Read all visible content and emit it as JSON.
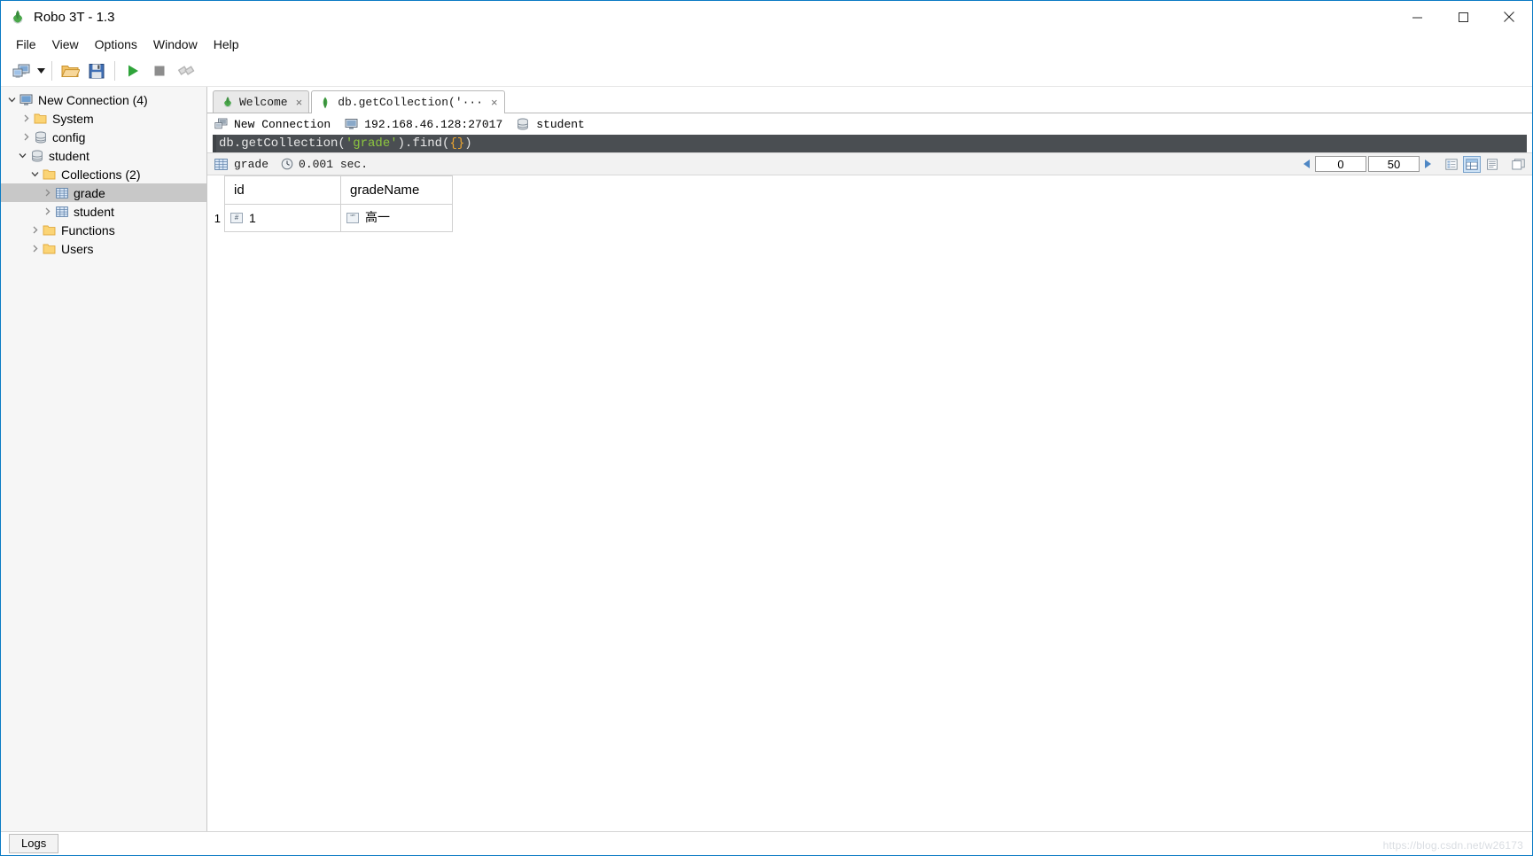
{
  "window": {
    "title": "Robo 3T - 1.3",
    "logo_icon": "robo3t-leaf-logo",
    "minimize_icon": "minimize-icon",
    "maximize_icon": "maximize-icon",
    "close_icon": "close-icon"
  },
  "menubar": {
    "items": [
      {
        "label": "File"
      },
      {
        "label": "View"
      },
      {
        "label": "Options"
      },
      {
        "label": "Window"
      },
      {
        "label": "Help"
      }
    ]
  },
  "toolbar": {
    "buttons": [
      {
        "name": "connect-button",
        "icon": "computer-connect-icon"
      },
      {
        "name": "connect-dropdown",
        "icon": "chevron-down-icon"
      },
      {
        "name": "open-script-button",
        "icon": "open-folder-icon"
      },
      {
        "name": "save-script-button",
        "icon": "floppy-disk-icon"
      },
      {
        "name": "execute-button",
        "icon": "play-triangle-icon"
      },
      {
        "name": "stop-button",
        "icon": "stop-square-icon"
      },
      {
        "name": "orientation-button",
        "icon": "wrench-icon"
      }
    ]
  },
  "sidebar": {
    "tree": [
      {
        "label": "New Connection (4)",
        "icon": "computer-icon",
        "indent": 0,
        "twisty": "expanded",
        "selected": false
      },
      {
        "label": "System",
        "icon": "folder-icon",
        "indent": 1,
        "twisty": "collapsed",
        "selected": false
      },
      {
        "label": "config",
        "icon": "database-icon",
        "indent": 1,
        "twisty": "collapsed",
        "selected": false
      },
      {
        "label": "student",
        "icon": "database-icon",
        "indent": 1,
        "twisty": "expanded",
        "selected": false
      },
      {
        "label": "Collections (2)",
        "icon": "folder-icon",
        "indent": 2,
        "twisty": "expanded",
        "selected": false
      },
      {
        "label": "grade",
        "icon": "collection-grid-icon",
        "indent": 3,
        "twisty": "collapsed",
        "selected": true
      },
      {
        "label": "student",
        "icon": "collection-grid-icon",
        "indent": 3,
        "twisty": "collapsed",
        "selected": false
      },
      {
        "label": "Functions",
        "icon": "folder-icon",
        "indent": 2,
        "twisty": "collapsed",
        "selected": false
      },
      {
        "label": "Users",
        "icon": "folder-icon",
        "indent": 2,
        "twisty": "collapsed",
        "selected": false
      }
    ]
  },
  "tabs": [
    {
      "label": "Welcome",
      "icon": "robo3t-leaf-logo",
      "active": false,
      "close_icon": "close-icon",
      "close_label": "×"
    },
    {
      "label": "db.getCollection('···",
      "icon": "mongo-leaf-icon",
      "active": true,
      "close_icon": "close-icon",
      "close_label": "×"
    }
  ],
  "info_bar": {
    "connection": "New Connection",
    "connection_icon": "server-icon",
    "host": "192.168.46.128:27017",
    "host_icon": "computer-icon",
    "database": "student",
    "database_icon": "database-icon"
  },
  "editor": {
    "prefix": "db.getCollection(",
    "string": "'grade'",
    "middle": ").find(",
    "braces": "{}",
    "suffix": ")"
  },
  "result_toolbar": {
    "grid_icon": "grid-icon",
    "collection_name": "grade",
    "clock_icon": "clock-icon",
    "elapsed": "0.001 sec.",
    "prev_icon": "left-arrow-icon",
    "next_icon": "right-arrow-icon",
    "skip_value": "0",
    "limit_value": "50",
    "view_modes": [
      {
        "name": "tree-view-button",
        "icon": "tree-view-icon",
        "active": false
      },
      {
        "name": "table-view-button",
        "icon": "table-view-icon",
        "active": true
      },
      {
        "name": "text-view-button",
        "icon": "text-view-icon",
        "active": false
      },
      {
        "name": "maximize-results-button",
        "icon": "expand-icon",
        "active": false
      }
    ]
  },
  "results_table": {
    "columns": [
      "id",
      "gradeName"
    ],
    "rows": [
      {
        "index": "1",
        "cells": [
          {
            "value": "1",
            "type_icon": "int-type-icon",
            "type_glyph": "#"
          },
          {
            "value": "高一",
            "type_icon": "string-type-icon",
            "type_glyph": "“”",
            "cjk": true
          }
        ]
      }
    ]
  },
  "bottom_bar": {
    "logs_label": "Logs",
    "watermark": "https://blog.csdn.net/w26173"
  }
}
